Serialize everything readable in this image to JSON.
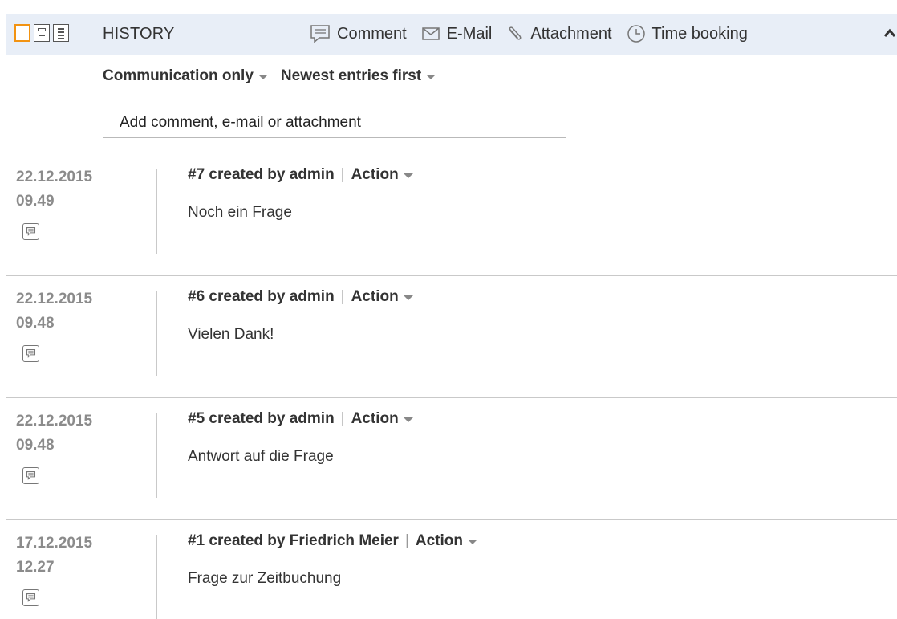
{
  "header": {
    "title": "HISTORY",
    "actions": [
      {
        "label": "Comment",
        "icon": "comment-icon"
      },
      {
        "label": "E-Mail",
        "icon": "mail-icon"
      },
      {
        "label": "Attachment",
        "icon": "paperclip-icon"
      },
      {
        "label": "Time booking",
        "icon": "clock-icon"
      }
    ],
    "accent_color": "#f29312",
    "background_color": "#e8eef7"
  },
  "filters": {
    "communication": "Communication only",
    "sort": "Newest entries first"
  },
  "add_field": {
    "placeholder": "Add comment, e-mail or attachment"
  },
  "entries": [
    {
      "date": "22.12.2015",
      "time": "09.49",
      "title": "#7 created by admin",
      "action": "Action",
      "text": "Noch ein Frage",
      "type_icon": "comment-icon"
    },
    {
      "date": "22.12.2015",
      "time": "09.48",
      "title": "#6 created by admin",
      "action": "Action",
      "text": "Vielen Dank!",
      "type_icon": "comment-icon"
    },
    {
      "date": "22.12.2015",
      "time": "09.48",
      "title": "#5 created by admin",
      "action": "Action",
      "text": "Antwort auf die Frage",
      "type_icon": "comment-icon"
    },
    {
      "date": "17.12.2015",
      "time": "12.27",
      "title": "#1 created by Friedrich Meier",
      "action": "Action",
      "text": "Frage zur Zeitbuchung",
      "type_icon": "comment-icon"
    }
  ]
}
